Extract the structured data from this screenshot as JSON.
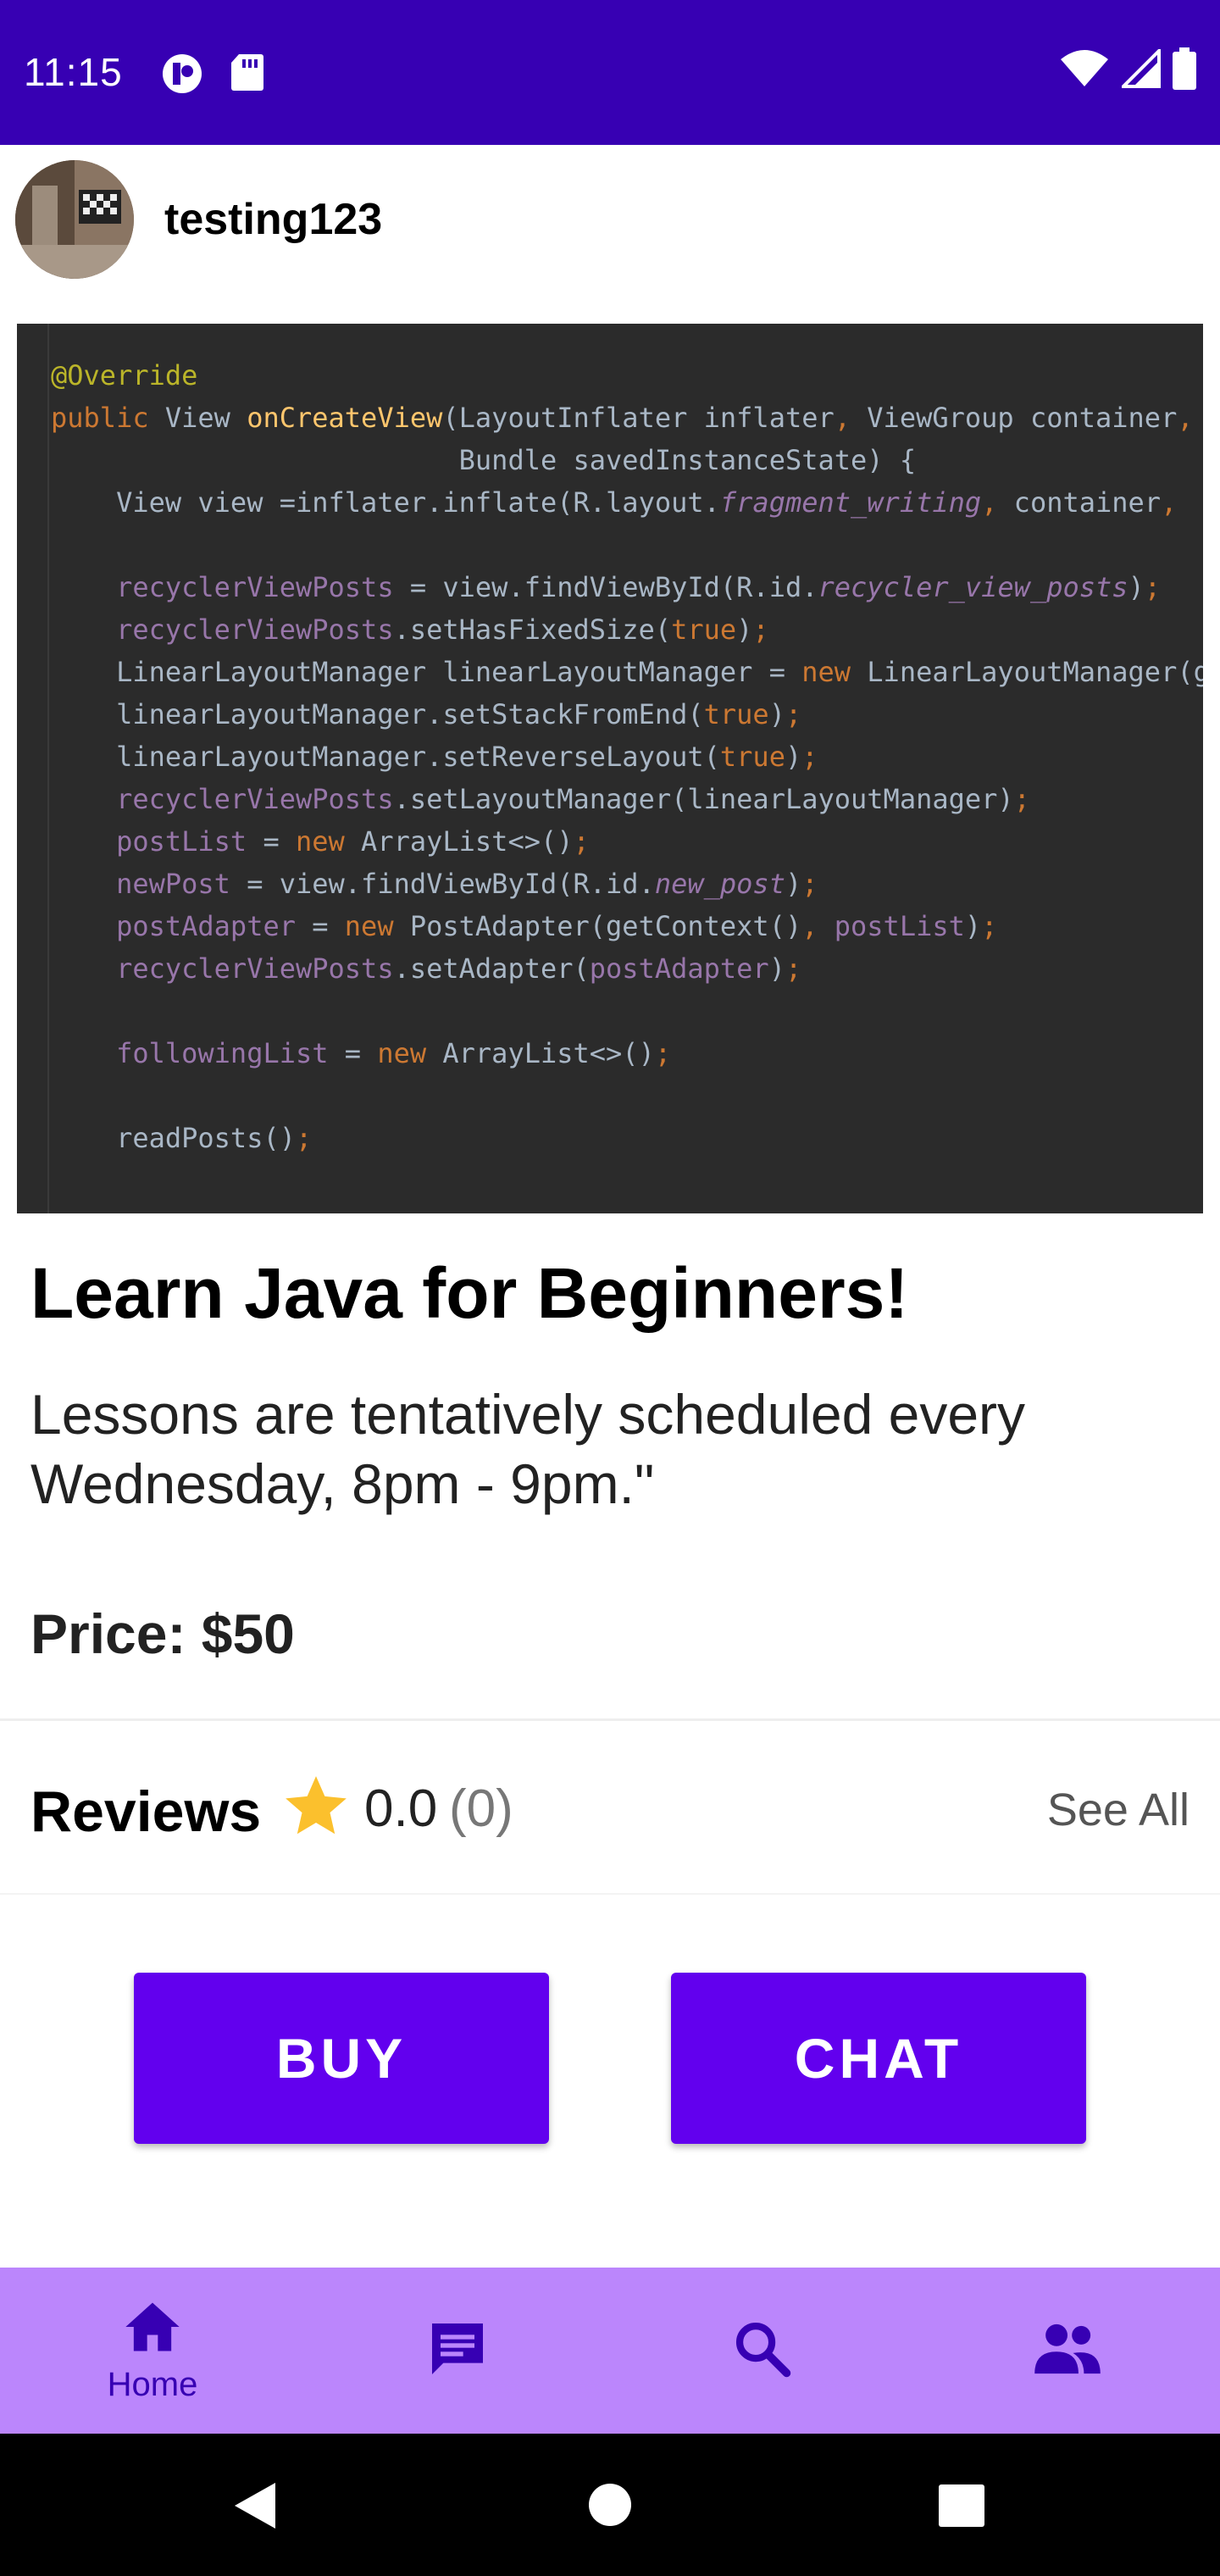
{
  "status_bar": {
    "time": "11:15",
    "left_icons": [
      "notification-app-icon",
      "sd-card-icon"
    ],
    "right_icons": [
      "wifi-icon",
      "signal-icon",
      "battery-icon"
    ]
  },
  "profile": {
    "username": "testing123"
  },
  "code_image": {
    "lines": [
      "@Override",
      "public View onCreateView(LayoutInflater inflater, ViewGroup container,",
      "                         Bundle savedInstanceState) {",
      "    View view =inflater.inflate(R.layout.fragment_writing, container,",
      "",
      "    recyclerViewPosts = view.findViewById(R.id.recycler_view_posts);",
      "    recyclerViewPosts.setHasFixedSize(true);",
      "    LinearLayoutManager linearLayoutManager = new LinearLayoutManager(g",
      "    linearLayoutManager.setStackFromEnd(true);",
      "    linearLayoutManager.setReverseLayout(true);",
      "    recyclerViewPosts.setLayoutManager(linearLayoutManager);",
      "    postList = new ArrayList<>();",
      "    newPost = view.findViewById(R.id.new_post);",
      "    postAdapter = new PostAdapter(getContext(), postList);",
      "    recyclerViewPosts.setAdapter(postAdapter);",
      "",
      "    followingList = new ArrayList<>();",
      "",
      "    readPosts();"
    ]
  },
  "listing": {
    "title": "Learn Java for Beginners!",
    "description": "Lessons are tentatively scheduled every Wednesday, 8pm - 9pm.\"",
    "price": "Price: $50"
  },
  "reviews": {
    "label": "Reviews",
    "rating": "0.0",
    "count": "(0)",
    "see_all": "See All",
    "star_color": "#fbc02d"
  },
  "actions": {
    "buy": "BUY",
    "chat": "CHAT"
  },
  "bottom_nav": {
    "items": [
      {
        "label": "Home",
        "icon": "home-icon",
        "active": true
      },
      {
        "label": "",
        "icon": "chat-icon"
      },
      {
        "label": "",
        "icon": "search-icon"
      },
      {
        "label": "",
        "icon": "people-icon"
      }
    ]
  },
  "colors": {
    "status_bar": "#3700b3",
    "primary_button": "#6200ee",
    "nav_background": "#bb86fc",
    "nav_icon": "#3700b3"
  }
}
